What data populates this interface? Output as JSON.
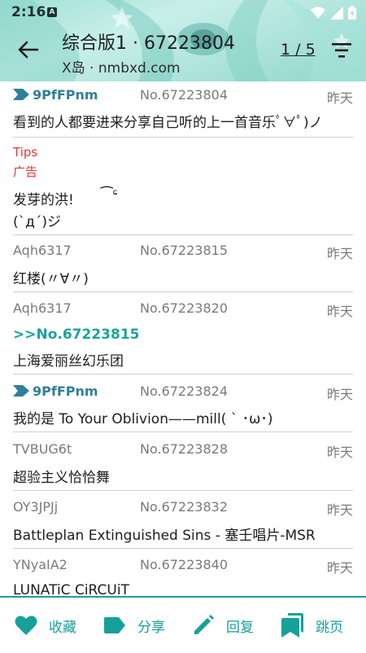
{
  "status_bar": {
    "time": "2:16",
    "badge": "A"
  },
  "header": {
    "title": "综合版1 · 67223804",
    "subtitle": "X岛 · nmbxd.com",
    "page_indicator": "1 / 5"
  },
  "colors": {
    "accent": "#1aa39a",
    "po": "#2f7f9a",
    "ad": "#e53935",
    "meta": "#7a7a7a"
  },
  "posts": [
    {
      "uid": "9PfFPnm",
      "is_po": true,
      "no": "No.67223804",
      "time": "昨天",
      "lines": [
        "看到的人都要进来分享自己听的上一首音乐ﾟ∀ﾟ)ノ"
      ]
    },
    {
      "tips": "Tips",
      "ad_label": "广告",
      "lines": [
        "发芽的洪!",
        "(`д´)ジ"
      ],
      "emoticon": "⁀ᶝ"
    },
    {
      "uid": "Aqh6317",
      "is_po": false,
      "no": "No.67223815",
      "time": "昨天",
      "lines": [
        "红楼(〃∀〃)"
      ]
    },
    {
      "uid": "Aqh6317",
      "is_po": false,
      "no": "No.67223820",
      "time": "昨天",
      "ref": ">>No.67223815",
      "lines": [
        "上海爱丽丝幻乐团"
      ]
    },
    {
      "uid": "9PfFPnm",
      "is_po": true,
      "no": "No.67223824",
      "time": "昨天",
      "lines": [
        "我的是 To Your Oblivion——mill( ` ･ω･)"
      ]
    },
    {
      "uid": "TVBUG6t",
      "is_po": false,
      "no": "No.67223828",
      "time": "昨天",
      "lines": [
        "超验主义恰恰舞"
      ]
    },
    {
      "uid": "OY3JPJj",
      "is_po": false,
      "no": "No.67223832",
      "time": "昨天",
      "lines": [
        "Battleplan Extinguished Sins - 塞壬唱片-MSR"
      ]
    },
    {
      "uid": "YNyaIA2",
      "is_po": false,
      "no": "No.67223840",
      "time": "昨天",
      "lines": [
        "LUNATiC CiRCUiT"
      ]
    }
  ],
  "bottom_bar": {
    "favorite": {
      "label": "收藏",
      "icon": "heart-icon"
    },
    "share": {
      "label": "分享",
      "icon": "tag-icon"
    },
    "reply": {
      "label": "回复",
      "icon": "pencil-icon"
    },
    "jump": {
      "label": "跳页",
      "icon": "bookmarks-icon"
    }
  }
}
